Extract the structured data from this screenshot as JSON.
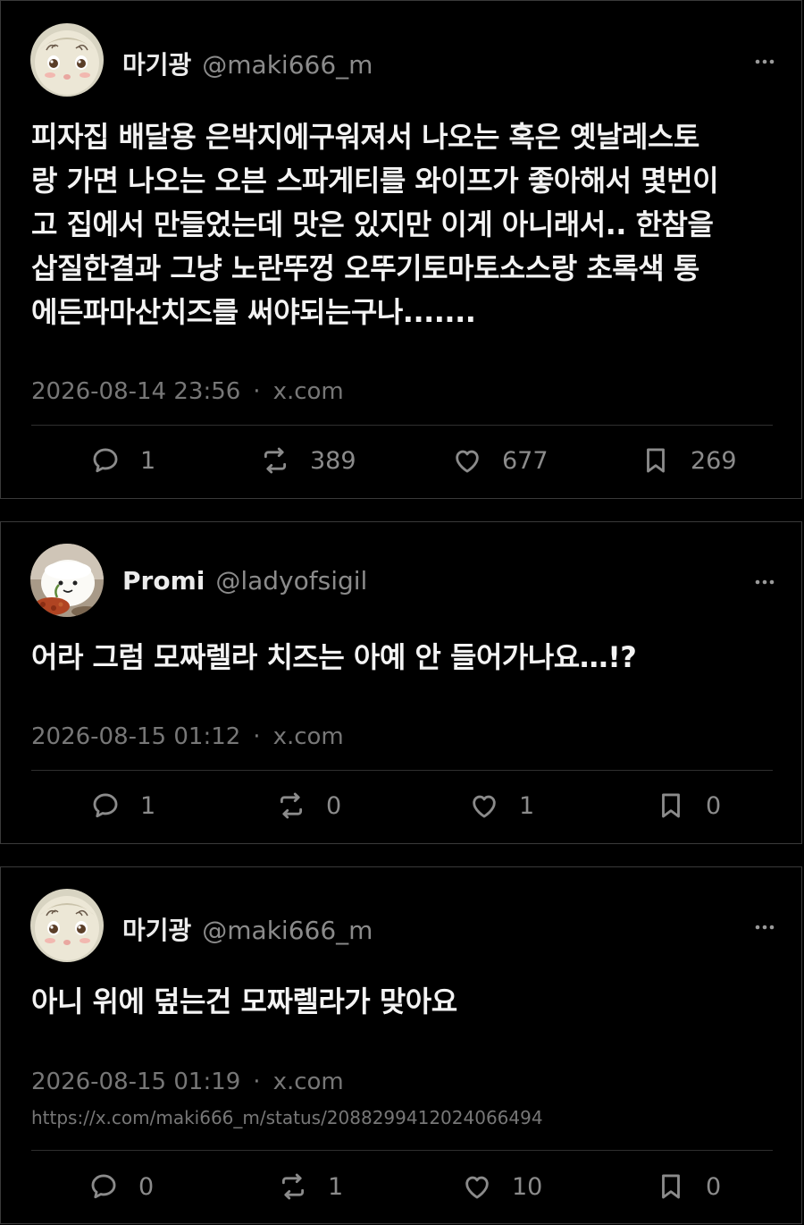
{
  "posts": [
    {
      "display_name": "마기광",
      "handle": "@maki666_m",
      "text": "피자집 배달용 은박지에구워져서 나오는 혹은 옛날레스토랑 가면 나오는 오븐 스파게티를 와이프가 좋아해서 몇번이고 집에서 만들었는데 맛은 있지만 이게 아니래서.. 한참을 삽질한결과 그냥 노란뚜껑 오뚜기토마토소스랑 초록색 통에든파마산치즈를 써야되는구나.......",
      "text_lines": [
        "피자집 배달용 은박지에구워져서 나오는 혹은 옛날레스토",
        "랑 가면 나오는 오븐 스파게티를 와이프가 좋아해서 몇번이",
        "고 집에서 만들었는데 맛은 있지만 이게 아니래서.. 한참을",
        "삽질한결과 그냥 노란뚜껑 오뚜기토마토소스랑 초록색 통",
        "에든파마산치즈를 써야되는구나......."
      ],
      "timestamp": "2026-08-14 23:56",
      "source": "x.com",
      "replies": "1",
      "reposts": "389",
      "likes": "677",
      "bookmarks": "269",
      "avatar_icon": "plush-doll-face-avatar"
    },
    {
      "display_name": "Promi",
      "handle": "@ladyofsigil",
      "text": "어라 그럼 모짜렐라 치즈는 아예 안 들어가나요…!?",
      "timestamp": "2026-08-15 01:12",
      "source": "x.com",
      "replies": "1",
      "reposts": "0",
      "likes": "1",
      "bookmarks": "0",
      "avatar_icon": "mochi-character-avatar"
    },
    {
      "display_name": "마기광",
      "handle": "@maki666_m",
      "text": "아니 위에 덮는건 모짜렐라가 맞아요",
      "timestamp": "2026-08-15 01:19",
      "source": "x.com",
      "url": "https://x.com/maki666_m/status/2088299412024066494",
      "replies": "0",
      "reposts": "1",
      "likes": "10",
      "bookmarks": "0",
      "avatar_icon": "plush-doll-face-avatar"
    }
  ],
  "icons": {
    "reply": "speech-bubble-icon",
    "repost": "repost-arrows-icon",
    "like": "heart-icon",
    "bookmark": "bookmark-icon",
    "more": "ellipsis-icon"
  },
  "colors": {
    "background": "#000000",
    "text": "#f3f3f3",
    "muted": "#8b8b8b",
    "border": "#3a3a3a"
  }
}
